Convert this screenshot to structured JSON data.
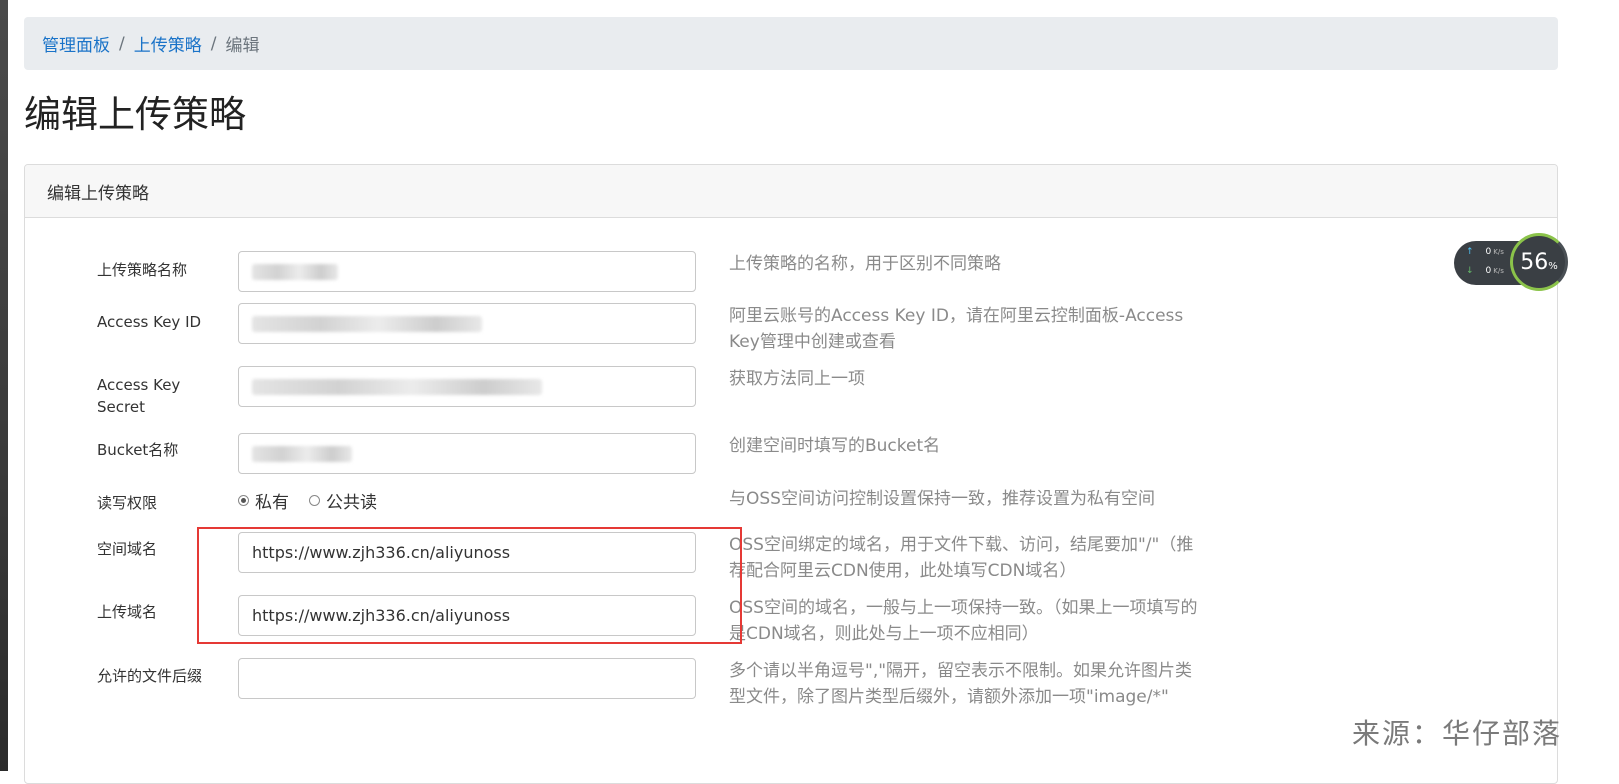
{
  "breadcrumb": {
    "items": [
      "管理面板",
      "上传策略"
    ],
    "separator": "/",
    "current": "编辑"
  },
  "page_title": "编辑上传策略",
  "card_title": "编辑上传策略",
  "form": {
    "policy_name": {
      "label": "上传策略名称",
      "help": "上传策略的名称，用于区别不同策略"
    },
    "access_key_id": {
      "label": "Access Key ID",
      "help": "阿里云账号的Access Key ID，请在阿里云控制面板-Access Key管理中创建或查看"
    },
    "access_key_secret": {
      "label": "Access Key Secret",
      "help": "获取方法同上一项"
    },
    "bucket": {
      "label": "Bucket名称",
      "help": "创建空间时填写的Bucket名"
    },
    "permission": {
      "label": "读写权限",
      "options": [
        "私有",
        "公共读"
      ],
      "selected": "私有",
      "help": "与OSS空间访问控制设置保持一致，推荐设置为私有空间"
    },
    "space_domain": {
      "label": "空间域名",
      "value": "https://www.zjh336.cn/aliyunoss",
      "help": "OSS空间绑定的域名，用于文件下载、访问，结尾要加\"/\"（推荐配合阿里云CDN使用，此处填写CDN域名）"
    },
    "upload_domain": {
      "label": "上传域名",
      "value": "https://www.zjh336.cn/aliyunoss",
      "help": "OSS空间的域名，一般与上一项保持一致。（如果上一项填写的是CDN域名，则此处与上一项不应相同）"
    },
    "allowed_ext": {
      "label": "允许的文件后缀",
      "value": "",
      "help": "多个请以半角逗号\",\"隔开，留空表示不限制。如果允许图片类型文件，除了图片类型后缀外，请额外添加一项\"image/*\""
    }
  },
  "speed_widget": {
    "upload": "0",
    "download": "0",
    "unit": "K/s",
    "gauge_value": "56",
    "gauge_unit": "%"
  },
  "watermark": "来源：华仔部落",
  "colors": {
    "link": "#1a73c8",
    "highlight": "#e53935",
    "help_text": "#8a8a8a"
  }
}
